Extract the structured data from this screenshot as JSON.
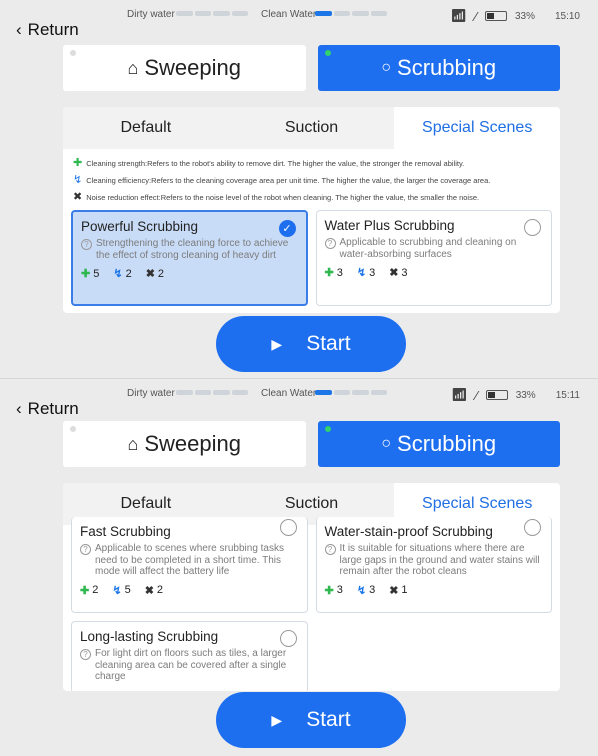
{
  "screens": [
    {
      "status": {
        "dirty_label": "Dirty water",
        "clean_label": "Clean Water",
        "battery": "33%",
        "time": "15:10"
      },
      "nav": {
        "return_label": "Return"
      },
      "modes": {
        "sweeping": "Sweeping",
        "scrubbing": "Scrubbing"
      },
      "tabs": [
        "Default",
        "Suction",
        "Special Scenes"
      ],
      "legend": {
        "strength": "Cleaning strength:Refers to the robot's ability to remove dirt. The higher the value, the stronger the removal ability.",
        "efficiency": "Cleaning efficiency:Refers to the cleaning coverage area per unit time. The higher the value, the larger the coverage area.",
        "noise": "Noise reduction effect:Refers to the noise level of the robot when cleaning. The higher the value, the smaller the noise."
      },
      "cards": [
        {
          "title": "Powerful Scrubbing",
          "desc": "Strengthening the cleaning force to achieve the effect of strong cleaning of heavy dirt",
          "strength": "5",
          "efficiency": "2",
          "noise": "2",
          "selected": true
        },
        {
          "title": "Water Plus Scrubbing",
          "desc": "Applicable to scrubbing and cleaning on water-absorbing surfaces",
          "strength": "3",
          "efficiency": "3",
          "noise": "3",
          "selected": false
        }
      ],
      "start_label": "Start"
    },
    {
      "status": {
        "dirty_label": "Dirty water",
        "clean_label": "Clean Water",
        "battery": "33%",
        "time": "15:11"
      },
      "nav": {
        "return_label": "Return"
      },
      "modes": {
        "sweeping": "Sweeping",
        "scrubbing": "Scrubbing"
      },
      "tabs": [
        "Default",
        "Suction",
        "Special Scenes"
      ],
      "cards": [
        {
          "title": "Fast Scrubbing",
          "desc": "Applicable to scenes where srubbing tasks need to be completed in a short time. This mode will affect the battery life",
          "strength": "2",
          "efficiency": "5",
          "noise": "2",
          "selected": false
        },
        {
          "title": "Water-stain-proof Scrubbing",
          "desc": "It is suitable for situations where there are large gaps in the ground and water stains will remain after the robot cleans",
          "strength": "3",
          "efficiency": "3",
          "noise": "1",
          "selected": false
        },
        {
          "title": "Long-lasting Scrubbing",
          "desc": "For light dirt on floors such as tiles, a larger cleaning area can be covered after a single charge",
          "selected": false
        }
      ],
      "start_label": "Start"
    }
  ],
  "colors": {
    "accent": "#1e6ff0",
    "strength_icon": "#2eb84f",
    "efficiency_icon": "#1c76e8"
  },
  "icons": {
    "strength": "strength-icon",
    "efficiency": "efficiency-icon",
    "noise": "noise-reduction-icon"
  }
}
